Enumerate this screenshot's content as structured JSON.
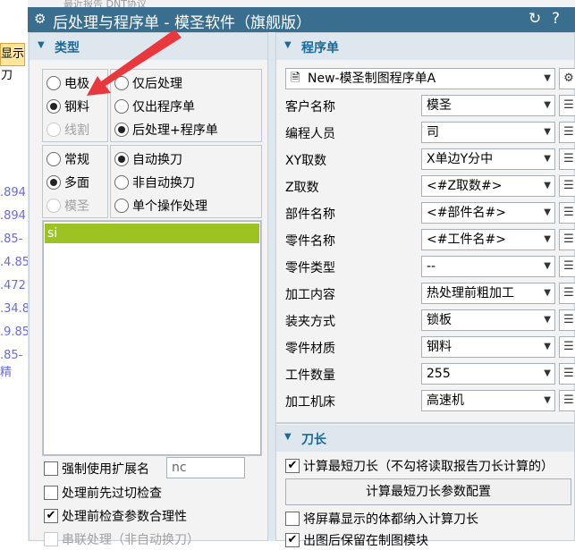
{
  "background": {
    "tab_label": "显示刀",
    "numbers": [
      ".894",
      ".894",
      ".85-",
      ".4.85",
      ".472",
      ".34.8",
      ".9.85",
      ".85-精"
    ],
    "top_text": "最近报告   DNT协议"
  },
  "title": {
    "text": "后处理与程序单 - 模圣软件（旗舰版）",
    "gear": "⚙",
    "refresh": "↻",
    "help": "?"
  },
  "type_panel": {
    "header": "类型",
    "arrow": "▼",
    "group1_left": [
      {
        "label": "电极",
        "checked": false,
        "disabled": false
      },
      {
        "label": "钢料",
        "checked": true,
        "disabled": false
      },
      {
        "label": "线割",
        "checked": false,
        "disabled": true
      }
    ],
    "group1_right": [
      {
        "label": "仅后处理",
        "checked": false
      },
      {
        "label": "仅出程序单",
        "checked": false
      },
      {
        "label": "后处理+程序单",
        "checked": true
      }
    ],
    "group2_left": [
      {
        "label": "常规",
        "checked": false,
        "disabled": false
      },
      {
        "label": "多面",
        "checked": true,
        "disabled": false
      },
      {
        "label": "模圣",
        "checked": false,
        "disabled": true
      }
    ],
    "group2_right": [
      {
        "label": "自动换刀",
        "checked": true
      },
      {
        "label": "非自动换刀",
        "checked": false
      },
      {
        "label": "单个操作处理",
        "checked": false
      }
    ],
    "list_items": [
      "si"
    ],
    "force_ext_label": "强制使用扩展名",
    "force_ext_value": "nc",
    "checks": [
      {
        "label": "处理前先过切检查",
        "checked": false
      },
      {
        "label": "处理前检查参数合理性",
        "checked": true
      },
      {
        "label": "串联处理（非自动换刀）",
        "checked": false
      }
    ]
  },
  "prog_panel": {
    "header": "程序单",
    "arrow": "▼",
    "template": "New-模圣制图程序单A",
    "fields": [
      {
        "label": "客户名称",
        "value": "模圣"
      },
      {
        "label": "编程人员",
        "value": "司"
      },
      {
        "label": "XY取数",
        "value": "X单边Y分中"
      },
      {
        "label": "Z取数",
        "value": "<#Z取数#>"
      },
      {
        "label": "部件名称",
        "value": "<#部件名#>"
      },
      {
        "label": "零件名称",
        "value": "<#工件名#>"
      },
      {
        "label": "零件类型",
        "value": "--"
      },
      {
        "label": "加工内容",
        "value": "热处理前粗加工"
      },
      {
        "label": "装夹方式",
        "value": "锁板"
      },
      {
        "label": "零件材质",
        "value": "钢料"
      },
      {
        "label": "工件数量",
        "value": "255"
      },
      {
        "label": "加工机床",
        "value": "高速机"
      }
    ]
  },
  "tool_panel": {
    "header": "刀长",
    "arrow": "▼",
    "calc_shortest": {
      "label": "计算最短刀长（不勾将读取报告刀长计算的）",
      "checked": true
    },
    "config_button": "计算最短刀长参数配置",
    "screen_bodies": {
      "label": "将屏幕显示的体都纳入计算刀长",
      "checked": false
    },
    "keep_drawing": {
      "label": "出图后保留在制图模块",
      "checked": true
    }
  },
  "colors": {
    "titlebar": "#3a6e8f",
    "header_text": "#1a6a9a",
    "selection": "#9dc322",
    "arrow": "#e8383d"
  }
}
